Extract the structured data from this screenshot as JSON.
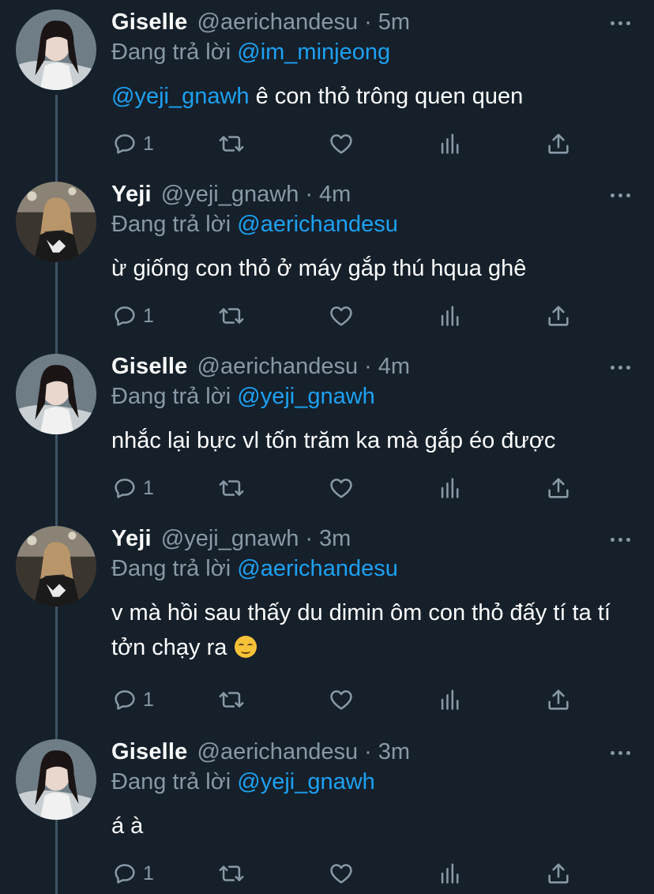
{
  "reply_prefix": "Đang trả lời",
  "tweets": [
    {
      "name": "Giselle",
      "handle": "@aerichandesu",
      "separator": "·",
      "time": "5m",
      "reply_to": "@im_minjeong",
      "mention": "@yeji_gnawh",
      "text": " ê con thỏ trông quen quen",
      "reply_count": "1",
      "avatar": "giselle-avatar"
    },
    {
      "name": "Yeji",
      "handle": "@yeji_gnawh",
      "separator": "·",
      "time": "4m",
      "reply_to": "@aerichandesu",
      "text": "ừ giống con thỏ ở máy gắp thú hqua ghê",
      "reply_count": "1",
      "avatar": "yeji-avatar"
    },
    {
      "name": "Giselle",
      "handle": "@aerichandesu",
      "separator": "·",
      "time": "4m",
      "reply_to": "@yeji_gnawh",
      "text": "nhắc lại bực vl tốn trăm ka mà gắp éo được",
      "reply_count": "1",
      "avatar": "giselle-avatar"
    },
    {
      "name": "Yeji",
      "handle": "@yeji_gnawh",
      "separator": "·",
      "time": "3m",
      "reply_to": "@aerichandesu",
      "text": "v mà hồi sau thấy du dimin ôm con thỏ đấy tí ta tí tởn chạy ra",
      "emoji": "smiling-face-emoji",
      "reply_count": "1",
      "avatar": "yeji-avatar"
    },
    {
      "name": "Giselle",
      "handle": "@aerichandesu",
      "separator": "·",
      "time": "3m",
      "reply_to": "@yeji_gnawh",
      "text": "á à",
      "reply_count": "1",
      "avatar": "giselle-avatar"
    }
  ],
  "icons": [
    "reply-icon",
    "retweet-icon",
    "like-icon",
    "analytics-icon",
    "share-icon",
    "more-icon"
  ],
  "colors": {
    "background": "#15202b",
    "text": "#ffffff",
    "secondary": "#8899a6",
    "link": "#1da1f2",
    "thread_line": "#3d5466"
  }
}
